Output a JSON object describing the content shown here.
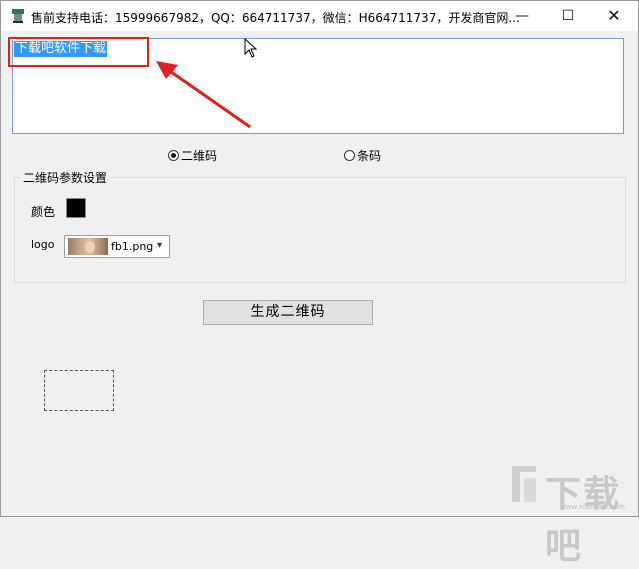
{
  "window": {
    "title": "售前支持电话：15999667982，QQ：664711737，微信：H664711737，开发商官网...",
    "minimize_glyph": "—",
    "maximize_glyph": "☐",
    "close_glyph": "✕"
  },
  "input": {
    "text": "下载吧软件下载"
  },
  "mode": {
    "options": [
      {
        "label": "二维码",
        "selected": true
      },
      {
        "label": "条码",
        "selected": false
      }
    ]
  },
  "qr_settings": {
    "group_title": "二维码参数设置",
    "color_label": "颜色",
    "color_value": "#000000",
    "logo_label": "logo",
    "logo_file": "fb1.png"
  },
  "actions": {
    "generate_label": "生成二维码"
  },
  "watermark": {
    "text": "下载吧",
    "url": "www.xiazaiba.com"
  },
  "colors": {
    "annotation": "#e02020",
    "selection": "#3399ff"
  }
}
